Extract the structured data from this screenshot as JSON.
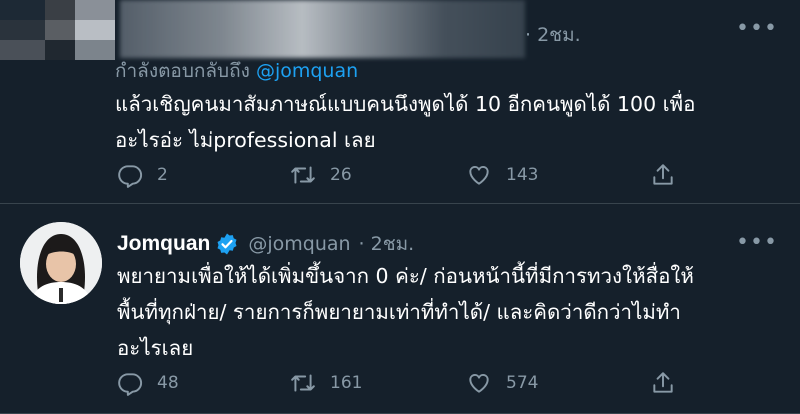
{
  "top_tweet": {
    "time": "· 2ชม.",
    "replying_prefix": "กำลังตอบกลับถึง",
    "replying_handle": "@jomquan",
    "text_lines": [
      "แล้วเชิญคนมาสัมภาษณ์แบบคนนึงพูดได้ 10 อีกคนพูดได้ 100 เพื่อ",
      "อะไรอ่ะ ไม่professional เลย"
    ],
    "actions": {
      "replies": "2",
      "retweets": "26",
      "likes": "143"
    }
  },
  "reply_tweet": {
    "name": "Jomquan",
    "handle": "@jomquan",
    "time": "· 2ชม.",
    "text_lines": [
      "พยายามเพื่อให้ได้เพิ่มขึ้นจาก 0 ค่ะ/ ก่อนหน้านี้ที่มีการทวงให้สื่อให้",
      "พื้นที่ทุกฝ่าย/ รายการก็พยายามเท่าที่ทำได้/ และคิดว่าดีกว่าไม่ทำ",
      "อะไรเลย"
    ],
    "actions": {
      "replies": "48",
      "retweets": "161",
      "likes": "574"
    }
  },
  "icons": {
    "more": "more-dots-icon",
    "reply": "reply-icon",
    "retweet": "retweet-icon",
    "like": "heart-icon",
    "share": "share-icon",
    "verified": "verified-badge-icon"
  },
  "colors": {
    "background": "#15202b",
    "text": "#ffffff",
    "muted": "#8899a6",
    "link": "#1da1f2",
    "divider": "#38444d"
  }
}
